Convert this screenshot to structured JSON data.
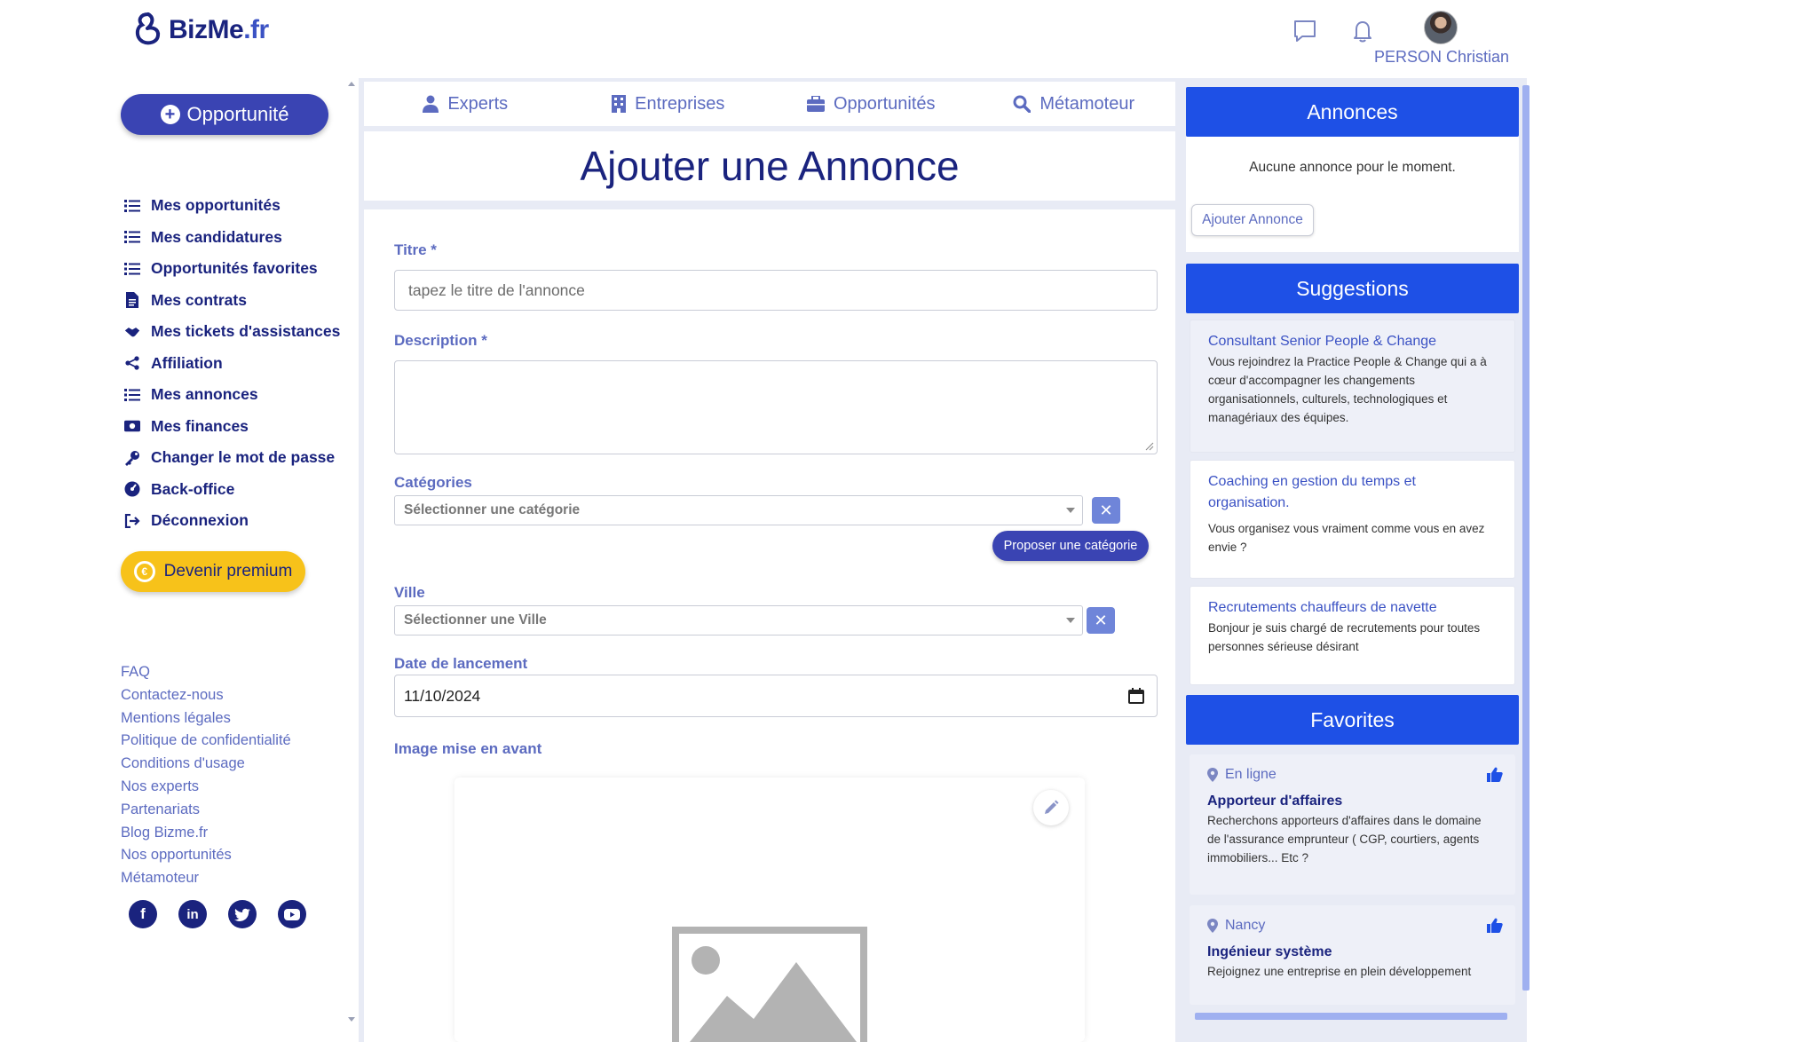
{
  "header": {
    "logo_text": "BizMe",
    "logo_suffix": ".fr",
    "user_name": "PERSON Christian",
    "chat_icon": "chat-icon",
    "bell_icon": "bell-icon"
  },
  "sidebar": {
    "opportunity_button": "Opportunité",
    "items": [
      {
        "label": "Mes opportunités",
        "icon": "list-icon"
      },
      {
        "label": "Mes candidatures",
        "icon": "list-icon"
      },
      {
        "label": "Opportunités favorites",
        "icon": "list-icon"
      },
      {
        "label": "Mes contrats",
        "icon": "file-icon"
      },
      {
        "label": "Mes tickets d'assistances",
        "icon": "handshake-icon"
      },
      {
        "label": "Affiliation",
        "icon": "share-icon"
      },
      {
        "label": "Mes annonces",
        "icon": "list-icon"
      },
      {
        "label": "Mes finances",
        "icon": "money-icon"
      },
      {
        "label": "Changer le mot de passe",
        "icon": "key-icon"
      },
      {
        "label": "Back-office",
        "icon": "dashboard-icon"
      },
      {
        "label": "Déconnexion",
        "icon": "logout-icon"
      }
    ],
    "premium_button": "Devenir premium",
    "footer_links": [
      "FAQ",
      "Contactez-nous",
      "Mentions légales",
      "Politique de confidentialité",
      "Conditions d'usage",
      "Nos experts",
      "Partenariats",
      "Blog Bizme.fr",
      "Nos opportunités",
      "Métamoteur"
    ],
    "socials": [
      "facebook-icon",
      "linkedin-icon",
      "twitter-icon",
      "youtube-icon"
    ]
  },
  "tabs": [
    {
      "label": "Experts",
      "icon": "person-icon"
    },
    {
      "label": "Entreprises",
      "icon": "building-icon"
    },
    {
      "label": "Opportunités",
      "icon": "briefcase-icon"
    },
    {
      "label": "Métamoteur",
      "icon": "search-icon"
    }
  ],
  "page_title": "Ajouter une Annonce",
  "form": {
    "title_label": "Titre *",
    "title_placeholder": "tapez le titre de l'annonce",
    "description_label": "Description *",
    "categories_label": "Catégories",
    "categories_placeholder": "Sélectionner une catégorie",
    "propose_button": "Proposer une catégorie",
    "city_label": "Ville",
    "city_placeholder": "Sélectionner une Ville",
    "launch_date_label": "Date de lancement",
    "launch_date_value": "11/10/2024",
    "image_label": "Image mise en avant"
  },
  "annonces": {
    "header": "Annonces",
    "empty_text": "Aucune annonce pour le moment.",
    "add_button": "Ajouter Annonce"
  },
  "suggestions": {
    "header": "Suggestions",
    "items": [
      {
        "title": "Consultant Senior People & Change",
        "desc": "Vous rejoindrez la Practice People & Change qui a à cœur d'accompagner les changements organisationnels, culturels, technologiques et managériaux des équipes."
      },
      {
        "title": "Coaching en gestion du temps et organisation.",
        "desc": "Vous organisez vous vraiment comme vous en avez envie ?"
      },
      {
        "title": "Recrutements chauffeurs de navette",
        "desc": "Bonjour je suis chargé de recrutements pour toutes personnes sérieuse désirant"
      }
    ]
  },
  "favorites": {
    "header": "Favorites",
    "items": [
      {
        "location": "En ligne",
        "title": "Apporteur d'affaires",
        "desc": "Recherchons apporteurs d'affaires dans le domaine de l'assurance emprunteur ( CGP, courtiers, agents immobiliers... Etc ?"
      },
      {
        "location": "Nancy",
        "title": "Ingénieur système",
        "desc": "Rejoignez une entreprise en plein développement"
      }
    ]
  },
  "colors": {
    "primary": "#1e50e6",
    "navy": "#1a237e",
    "accent": "#3a44b3",
    "premium": "#f7c21a"
  }
}
